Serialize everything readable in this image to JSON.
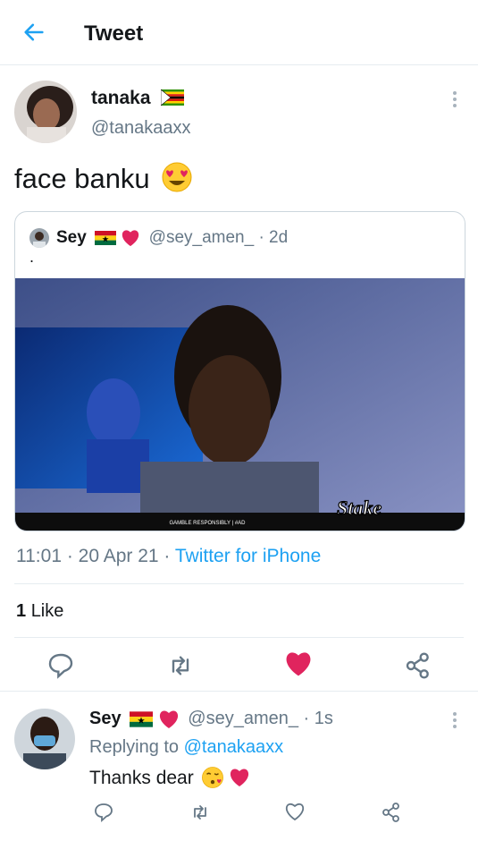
{
  "header": {
    "title": "Tweet"
  },
  "tweet": {
    "author_name": "tanaka",
    "author_handle": "@tanakaaxx",
    "text": "face banku",
    "timestamp": "11:01 · 20 Apr 21 ·",
    "source": "Twitter for iPhone",
    "like_count": "1",
    "like_label": "Like"
  },
  "quote": {
    "author_name": "Sey",
    "author_handle": "@sey_amen_ · 2d",
    "text": ".",
    "image_banner": "GAMBLE RESPONSIBLY | #AD",
    "image_logo": "Stake"
  },
  "reply": {
    "author_name": "Sey",
    "author_handle": "@sey_amen_ · 1s",
    "replying_prefix": "Replying to",
    "replying_to": "@tanakaaxx",
    "text": "Thanks dear"
  },
  "colors": {
    "accent": "#1da1f2",
    "like": "#e0245e",
    "muted": "#657786"
  }
}
